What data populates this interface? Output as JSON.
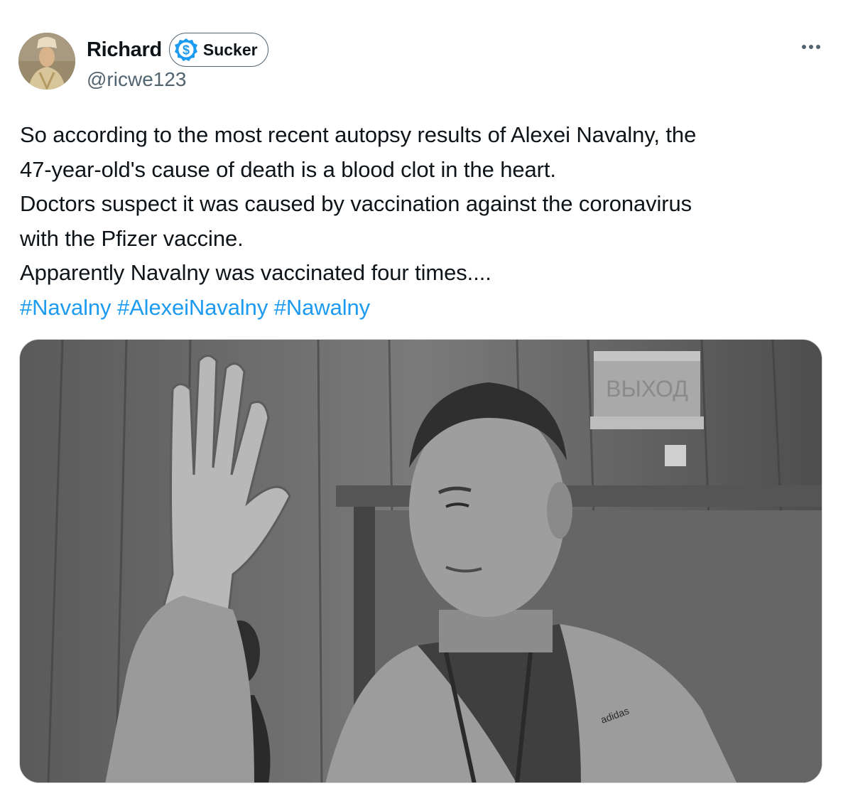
{
  "author": {
    "display_name": "Richard",
    "handle": "@ricwe123",
    "badge_label": "Sucker",
    "badge_icon": "dollar-circle-icon",
    "avatar_icon": "portrait-avatar"
  },
  "menu": {
    "icon": "more-dots-icon"
  },
  "tweet": {
    "lines": [
      "So according to the most recent autopsy results of Alexei Navalny, the",
      "47-year-old's cause of death is a blood clot in the heart.",
      "Doctors suspect it was caused by vaccination against the coronavirus",
      "with the Pfizer vaccine.",
      "Apparently Navalny was vaccinated four times...."
    ],
    "hashtags": [
      "#Navalny",
      "#AlexeiNavalny",
      "#Nawalny"
    ]
  },
  "media": {
    "sign_text": "ВЫХОД",
    "shirt_logo_text": "adidas"
  },
  "colors": {
    "link": "#1d9bf0",
    "text": "#0f1419",
    "secondary": "#536471",
    "badge_accent": "#1d9bf0"
  }
}
